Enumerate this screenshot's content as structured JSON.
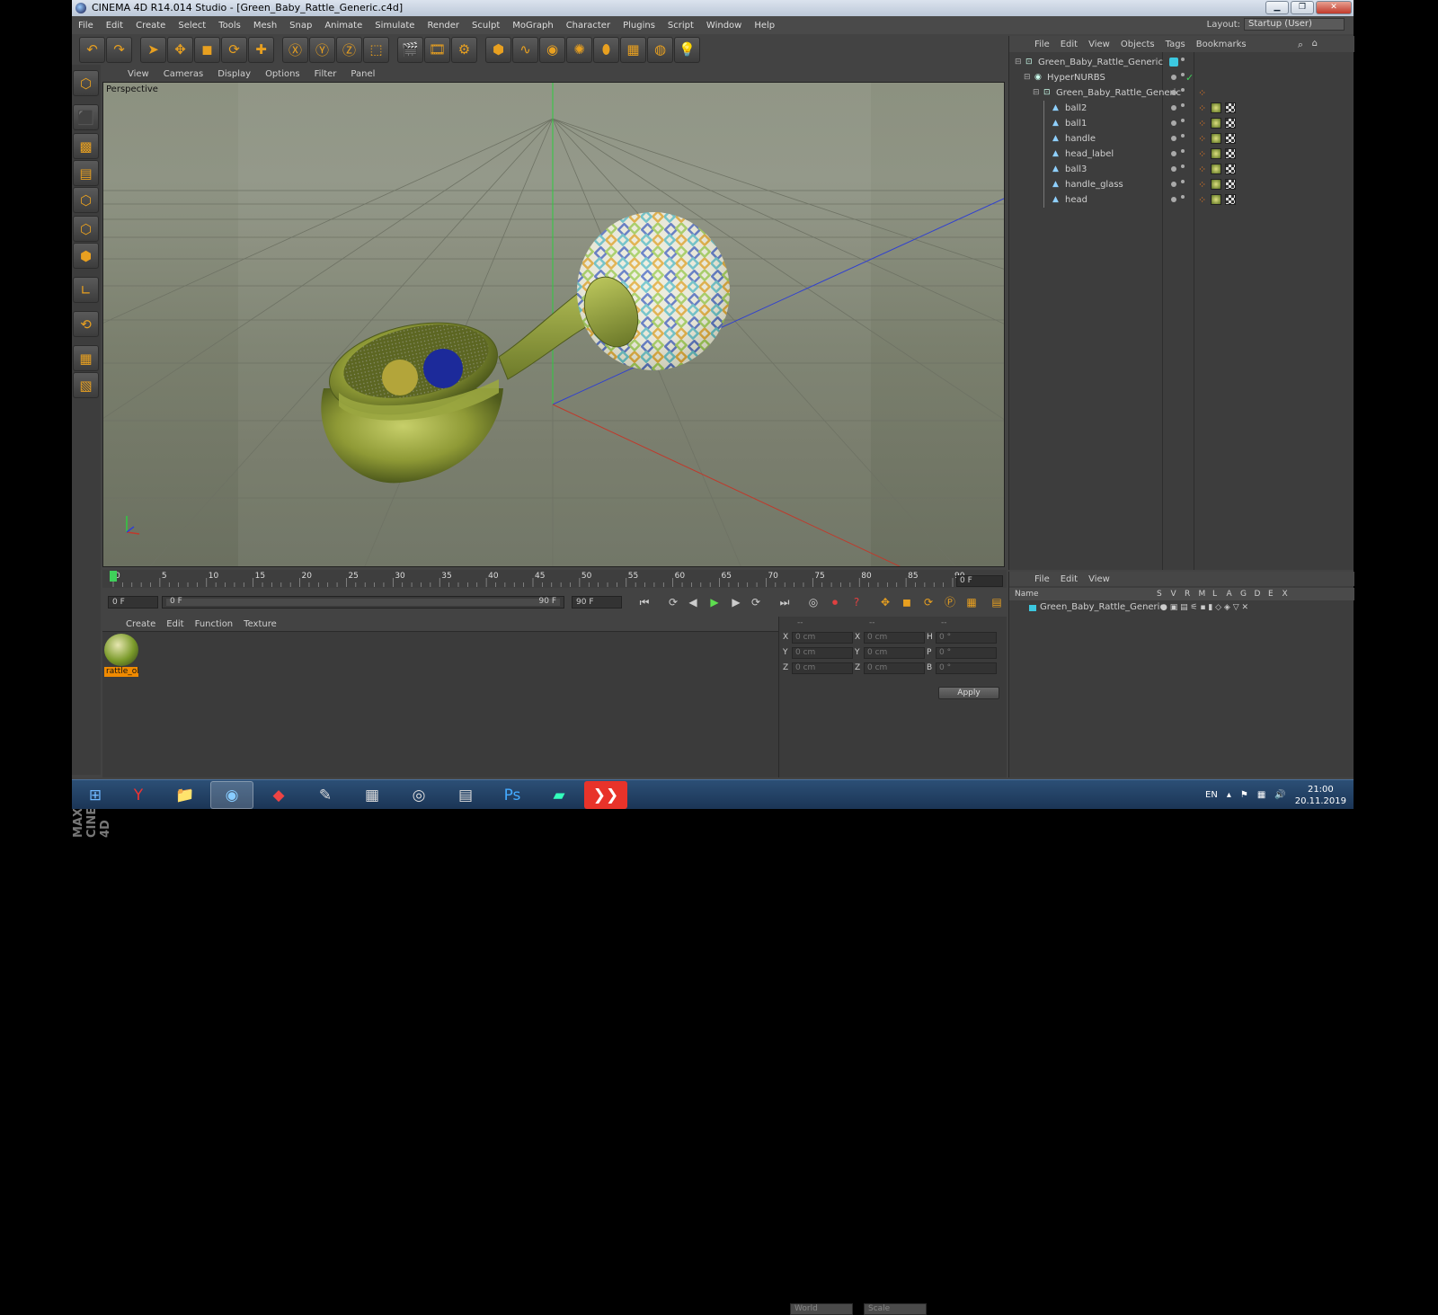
{
  "window": {
    "title": "CINEMA 4D R14.014 Studio - [Green_Baby_Rattle_Generic.c4d]",
    "min": "▁",
    "max": "❐",
    "close": "✕"
  },
  "menu": [
    "File",
    "Edit",
    "Create",
    "Select",
    "Tools",
    "Mesh",
    "Snap",
    "Animate",
    "Simulate",
    "Render",
    "Sculpt",
    "MoGraph",
    "Character",
    "Plugins",
    "Script",
    "Window",
    "Help"
  ],
  "layout": {
    "label": "Layout:",
    "value": "Startup (User)"
  },
  "toolbar": [
    {
      "name": "undo-icon",
      "g": "↶"
    },
    {
      "name": "redo-icon",
      "g": "↷"
    },
    {
      "name": "live-selection-icon",
      "g": "➤"
    },
    {
      "name": "move-icon",
      "g": "✥"
    },
    {
      "name": "scale-icon",
      "g": "◼"
    },
    {
      "name": "rotate-icon",
      "g": "⟳"
    },
    {
      "name": "recent-tool-icon",
      "g": "✚"
    },
    {
      "name": "lock-x-icon",
      "g": "Ⓧ"
    },
    {
      "name": "lock-y-icon",
      "g": "Ⓨ"
    },
    {
      "name": "lock-z-icon",
      "g": "Ⓩ"
    },
    {
      "name": "coordinate-system-icon",
      "g": "⬚"
    },
    {
      "name": "render-view-icon",
      "g": "🎬"
    },
    {
      "name": "render-picture-viewer-icon",
      "g": "🎞"
    },
    {
      "name": "edit-render-settings-icon",
      "g": "⚙"
    },
    {
      "name": "cube-icon",
      "g": "⬢"
    },
    {
      "name": "spline-pen-icon",
      "g": "∿"
    },
    {
      "name": "subdivision-surface-icon",
      "g": "◉"
    },
    {
      "name": "array-icon",
      "g": "✺"
    },
    {
      "name": "deformer-icon",
      "g": "⬮"
    },
    {
      "name": "floor-icon",
      "g": "▦"
    },
    {
      "name": "camera-icon",
      "g": "◍"
    },
    {
      "name": "light-icon",
      "g": "💡"
    }
  ],
  "lefttools": [
    {
      "name": "make-editable-icon",
      "g": "⬡"
    },
    {
      "name": "model-mode-icon",
      "g": "⬛"
    },
    {
      "name": "texture-mode-icon",
      "g": "▩"
    },
    {
      "name": "workplane-icon",
      "g": "▤"
    },
    {
      "name": "points-mode-icon",
      "g": "⬡"
    },
    {
      "name": "edges-mode-icon",
      "g": "⬡"
    },
    {
      "name": "polygons-mode-icon",
      "g": "⬢"
    },
    {
      "name": "axis-mode-icon",
      "g": "∟"
    },
    {
      "name": "tweak-mode-icon",
      "g": "⟲"
    },
    {
      "name": "snap-icon",
      "g": "▦"
    },
    {
      "name": "workplane-lock-icon",
      "g": "▧"
    }
  ],
  "c4dlogo": "MAXON CINEMA 4D",
  "viewport": {
    "menu": [
      "View",
      "Cameras",
      "Display",
      "Options",
      "Filter",
      "Panel"
    ],
    "label": "Perspective"
  },
  "timeline": {
    "ticks": [
      "0",
      "5",
      "10",
      "15",
      "20",
      "25",
      "30",
      "35",
      "40",
      "45",
      "50",
      "55",
      "60",
      "65",
      "70",
      "75",
      "80",
      "85",
      "90"
    ],
    "current": "0 F"
  },
  "playbar": {
    "start": "0 F",
    "slider_start": "0 F",
    "slider_end": "90 F",
    "end": "90 F"
  },
  "material_manager": {
    "menu": [
      "Create",
      "Edit",
      "Function",
      "Texture"
    ],
    "material": "rattle_ol"
  },
  "coords": {
    "headers": [
      "--",
      "--",
      "--"
    ],
    "rows": [
      {
        "a": "X",
        "av": "0 cm",
        "b": "X",
        "bv": "0 cm",
        "c": "H",
        "cv": "0 °"
      },
      {
        "a": "Y",
        "av": "0 cm",
        "b": "Y",
        "bv": "0 cm",
        "c": "P",
        "cv": "0 °"
      },
      {
        "a": "Z",
        "av": "0 cm",
        "b": "Z",
        "bv": "0 cm",
        "c": "B",
        "cv": "0 °"
      }
    ],
    "mode1": "World",
    "mode2": "Scale",
    "apply": "Apply"
  },
  "object_manager": {
    "menu": [
      "File",
      "Edit",
      "View",
      "Objects",
      "Tags",
      "Bookmarks"
    ],
    "objects": [
      {
        "name": "Green_Baby_Rattle_Generic",
        "depth": 0
      },
      {
        "name": "HyperNURBS",
        "depth": 1
      },
      {
        "name": "Green_Baby_Rattle_Generic",
        "depth": 2
      },
      {
        "name": "ball2",
        "depth": 3
      },
      {
        "name": "ball1",
        "depth": 3
      },
      {
        "name": "handle",
        "depth": 3
      },
      {
        "name": "head_label",
        "depth": 3
      },
      {
        "name": "ball3",
        "depth": 3
      },
      {
        "name": "handle_glass",
        "depth": 3
      },
      {
        "name": "head",
        "depth": 3
      }
    ]
  },
  "attributes": {
    "menu": [
      "File",
      "Edit",
      "View"
    ],
    "columns": [
      "Name",
      "S",
      "V",
      "R",
      "M",
      "L",
      "A",
      "G",
      "D",
      "E",
      "X"
    ],
    "row": "Green_Baby_Rattle_Generic"
  },
  "taskbar": {
    "apps": [
      {
        "name": "start-button",
        "g": "⊞"
      },
      {
        "name": "yandex-browser-icon",
        "g": "Y"
      },
      {
        "name": "file-explorer-icon",
        "g": "📁"
      },
      {
        "name": "cinema4d-taskbar-icon",
        "g": "◉"
      },
      {
        "name": "app-red-icon",
        "g": "◆"
      },
      {
        "name": "app-notes-icon",
        "g": "✎"
      },
      {
        "name": "calculator-icon",
        "g": "▦"
      },
      {
        "name": "app-viewer-icon",
        "g": "◎"
      },
      {
        "name": "app-document-icon",
        "g": "▤"
      },
      {
        "name": "photoshop-icon",
        "g": "Ps"
      },
      {
        "name": "app-green-icon",
        "g": "▰"
      },
      {
        "name": "anydesk-icon",
        "g": "❯❯"
      }
    ],
    "lang": "EN",
    "time": "21:00",
    "date": "20.11.2019"
  },
  "colors": {
    "accent": "#e8a020",
    "selection": "#f08a00",
    "axis_x": "#c0392b",
    "axis_y": "#2ecc40",
    "axis_z": "#3040d0"
  }
}
